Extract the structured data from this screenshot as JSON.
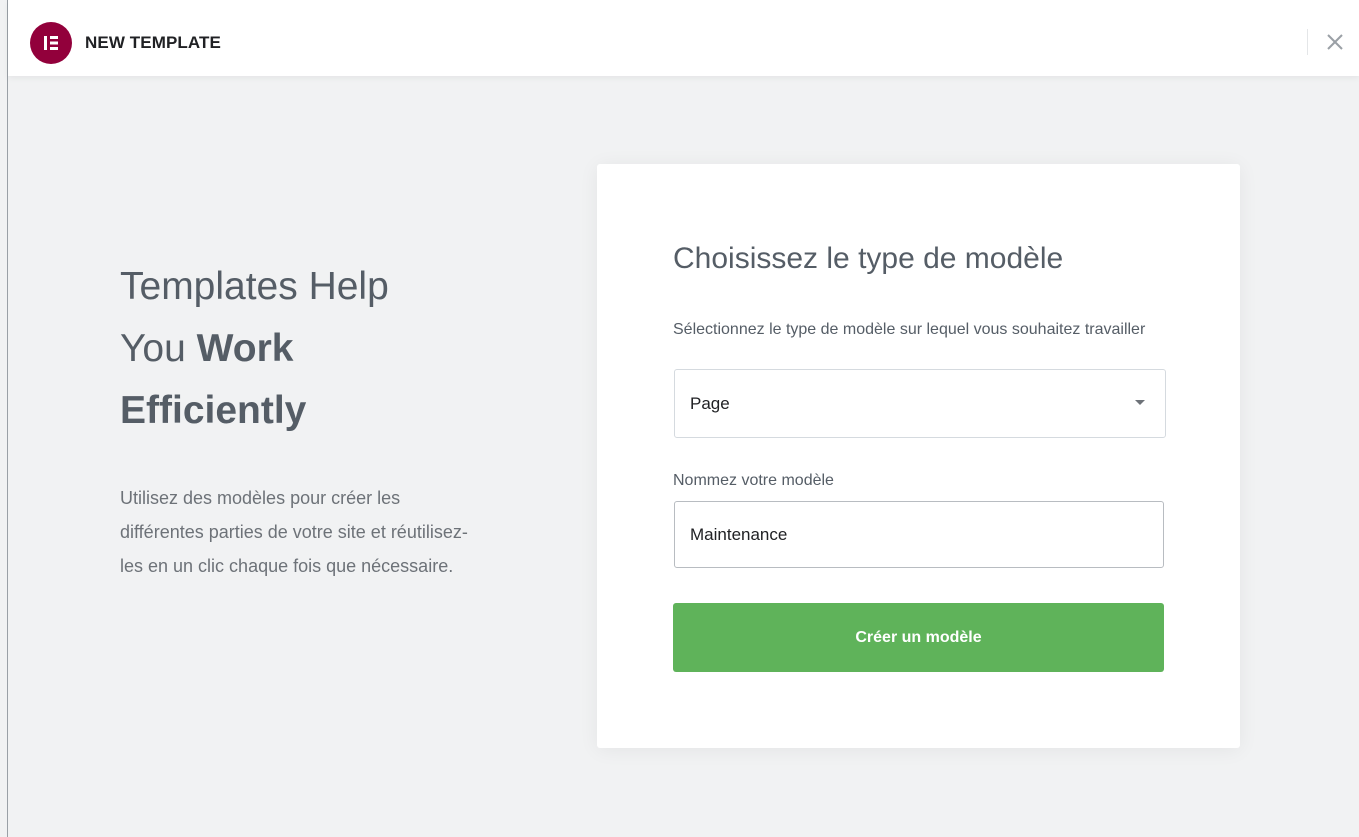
{
  "header": {
    "title": "NEW TEMPLATE",
    "logo_icon": "elementor-logo-icon",
    "close_icon": "close-icon",
    "brand_color": "#92003b"
  },
  "intro": {
    "title_line1": "Templates Help",
    "title_line2_plain": "You ",
    "title_line2_bold": "Work",
    "title_line3_bold": "Efficiently",
    "description": "Utilisez des modèles pour créer les différentes parties de votre site et réutilisez-les en un clic chaque fois que nécessaire."
  },
  "form": {
    "title": "Choisissez le type de modèle",
    "type_label": "Sélectionnez le type de modèle sur lequel vous souhaitez travailler",
    "type_value": "Page",
    "name_label": "Nommez votre modèle",
    "name_value": "Maintenance",
    "submit_label": "Créer un modèle",
    "submit_color": "#5fb35a"
  }
}
